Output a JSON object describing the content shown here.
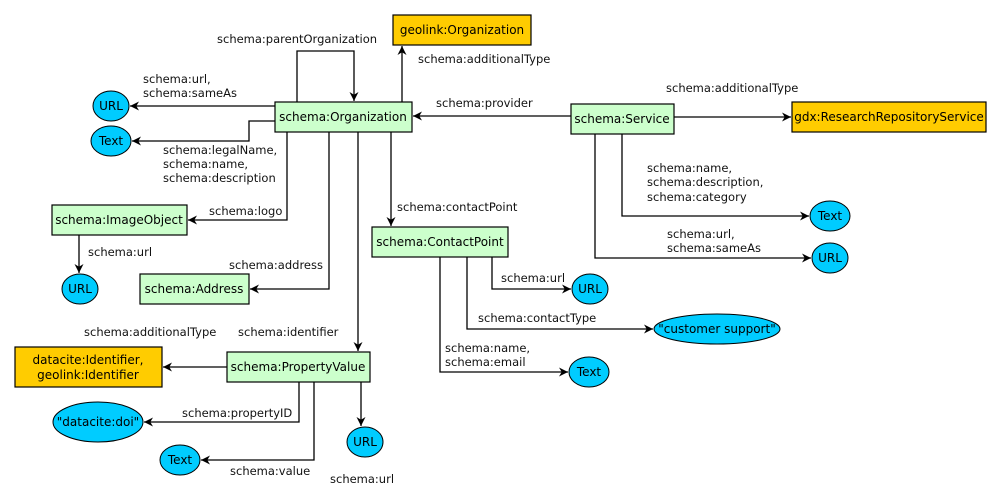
{
  "colors": {
    "class_fill": "#ccffcc",
    "type_fill": "#ffcc00",
    "literal_fill": "#00ccff"
  },
  "nodes": {
    "geolink_org": "geolink:Organization",
    "organization": "schema:Organization",
    "org_url": "URL",
    "org_text": "Text",
    "image_object": "schema:ImageObject",
    "image_url": "URL",
    "address": "schema:Address",
    "property_value": "schema:PropertyValue",
    "identifier_type_1": "datacite:Identifier,",
    "identifier_type_2": "geolink:Identifier",
    "datacite_doi": "\"datacite:doi\"",
    "pv_text": "Text",
    "pv_url": "URL",
    "contact_point": "schema:ContactPoint",
    "cp_url": "URL",
    "customer_support": "\"customer support\"",
    "cp_text": "Text",
    "service": "schema:Service",
    "gdx_type": "gdx:ResearchRepositoryService",
    "service_text": "Text",
    "service_url": "URL"
  },
  "edges": {
    "parent_org": "schema:parentOrganization",
    "org_additional_type": "schema:additionalType",
    "org_url_1": "schema:url,",
    "org_url_2": "schema:sameAs",
    "org_text_1": "schema:legalName,",
    "org_text_2": "schema:name,",
    "org_text_3": "schema:description",
    "logo": "schema:logo",
    "image_url": "schema:url",
    "address": "schema:address",
    "identifier": "schema:identifier",
    "contact_point": "schema:contactPoint",
    "provider": "schema:provider",
    "service_additional_type": "schema:additionalType",
    "service_text_1": "schema:name,",
    "service_text_2": "schema:description,",
    "service_text_3": "schema:category",
    "service_url_1": "schema:url,",
    "service_url_2": "schema:sameAs",
    "cp_url": "schema:url",
    "cp_contact_type": "schema:contactType",
    "cp_text_1": "schema:name,",
    "cp_text_2": "schema:email",
    "pv_additional_type": "schema:additionalType",
    "pv_property_id": "schema:propertyID",
    "pv_value": "schema:value",
    "pv_url": "schema:url"
  }
}
